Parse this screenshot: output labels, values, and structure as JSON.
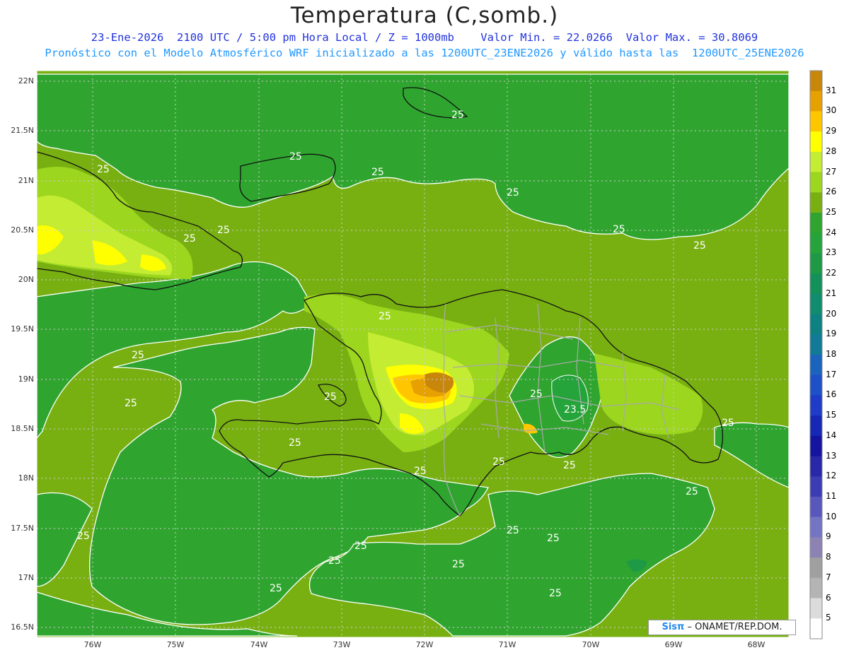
{
  "header": {
    "title": "Temperatura (C,somb.)",
    "line1": "23-Ene-2026  2100 UTC / 5:00 pm Hora Local / Z = 1000mb    Valor Min. = 22.0266  Valor Max. = 30.8069",
    "line2": "Pronóstico con el Modelo Atmosférico WRF inicializado a las 1200UTC_23ENE2026 y válido hasta las  1200UTC_25ENE2026"
  },
  "axes": {
    "lat_labels": [
      "22N",
      "21.5N",
      "21N",
      "20.5N",
      "20N",
      "19.5N",
      "19N",
      "18.5N",
      "18N",
      "17.5N",
      "17N",
      "16.5N"
    ],
    "lon_labels": [
      "76W",
      "75W",
      "74W",
      "73W",
      "72W",
      "71W",
      "70W",
      "69W",
      "68W"
    ]
  },
  "contour_labels": [
    "25",
    "25",
    "25",
    "25",
    "25",
    "25",
    "25",
    "25",
    "25",
    "25",
    "25",
    "25",
    "25",
    "25",
    "25",
    "25",
    "25",
    "25",
    "25",
    "25",
    "25",
    "25",
    "25",
    "25",
    "25",
    "25",
    "25",
    "23.5",
    "25"
  ],
  "colorbar": {
    "labels": [
      "31",
      "30",
      "29",
      "28",
      "27",
      "26",
      "25",
      "24",
      "23",
      "22",
      "21",
      "20",
      "19",
      "18",
      "17",
      "16",
      "15",
      "14",
      "13",
      "12",
      "11",
      "10",
      "9",
      "8",
      "7",
      "6",
      "5"
    ],
    "colors": [
      "#c8860a",
      "#e6a000",
      "#ffc600",
      "#ffff00",
      "#c3ec33",
      "#9cd61f",
      "#78b012",
      "#2fa52f",
      "#24a43a",
      "#1e9a46",
      "#14905a",
      "#108c6e",
      "#0e8282",
      "#117a96",
      "#1a64be",
      "#1e50c8",
      "#1e3cc8",
      "#1628b4",
      "#1414a0",
      "#2828a8",
      "#3c3cb4",
      "#5858bc",
      "#7474c4",
      "#8c82b4",
      "#a0a0a0",
      "#b4b4b4",
      "#dcdcdc",
      "#ffffff"
    ]
  },
  "field_colors": {
    "t24": "#2fa52f",
    "t25": "#78b012",
    "t26": "#9cd61f",
    "t27": "#c3ec33",
    "t28": "#ffff00",
    "t29": "#ffc600",
    "t30": "#e6a000",
    "t31": "#c8860a",
    "t23": "#24a43a",
    "t22": "#1e9a46"
  },
  "credit": {
    "brand": "Sisπ",
    "text": "– ONAMET/REP.DOM."
  }
}
